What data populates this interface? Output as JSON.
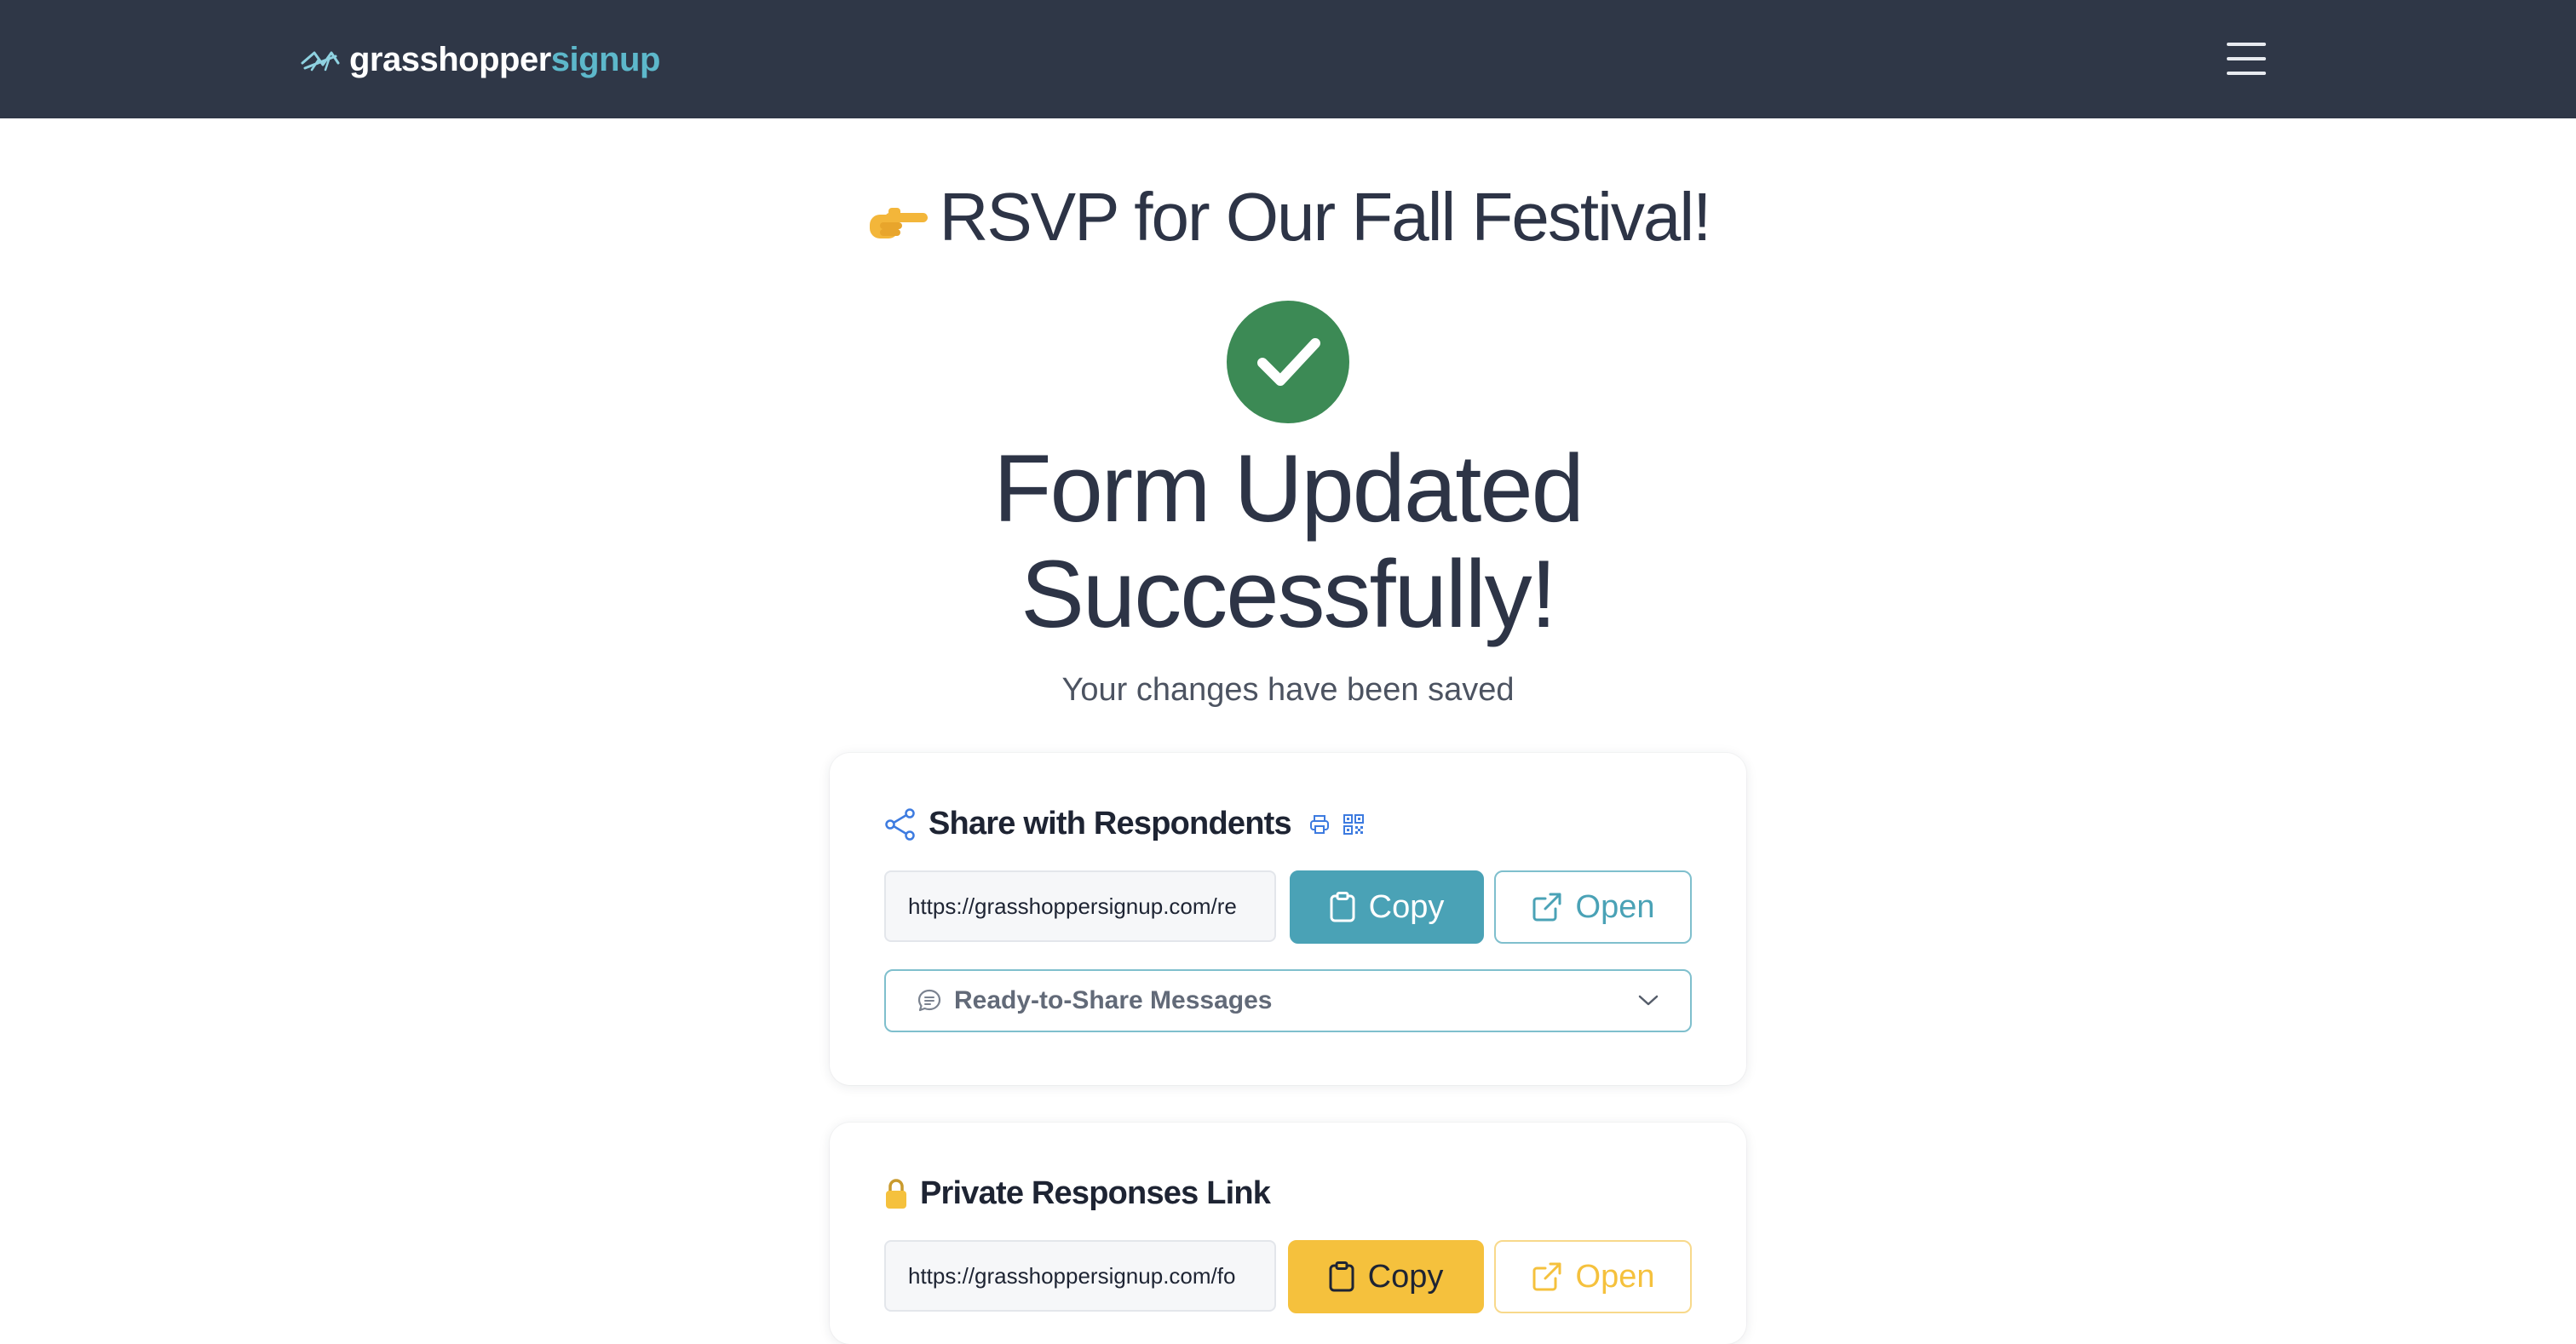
{
  "brand": {
    "name_part1": "grasshopper",
    "name_part2": "signup",
    "icon": "grasshopper-icon"
  },
  "header": {
    "menu_icon": "hamburger-menu-icon"
  },
  "page_title": "RSVP for Our Fall Festival!",
  "status": {
    "icon": "check-circle-icon",
    "headline_line1": "Form Updated",
    "headline_line2": "Successfully!",
    "subtext": "Your changes have been saved"
  },
  "share_card": {
    "title": "Share with Respondents",
    "icons": [
      "share-icon",
      "print-icon",
      "qr-code-icon"
    ],
    "url": "https://grasshoppersignup.com/re",
    "copy_label": "Copy",
    "open_label": "Open",
    "messages_label": "Ready-to-Share Messages"
  },
  "private_card": {
    "title": "Private Responses Link",
    "icon": "lock-icon",
    "url": "https://grasshoppersignup.com/fo",
    "copy_label": "Copy",
    "open_label": "Open"
  },
  "colors": {
    "header_bg": "#2f3747",
    "accent_teal": "#4aa2b6",
    "accent_yellow": "#f5c13d",
    "success_green": "#3c8a55",
    "text_dark": "#2d3446"
  }
}
